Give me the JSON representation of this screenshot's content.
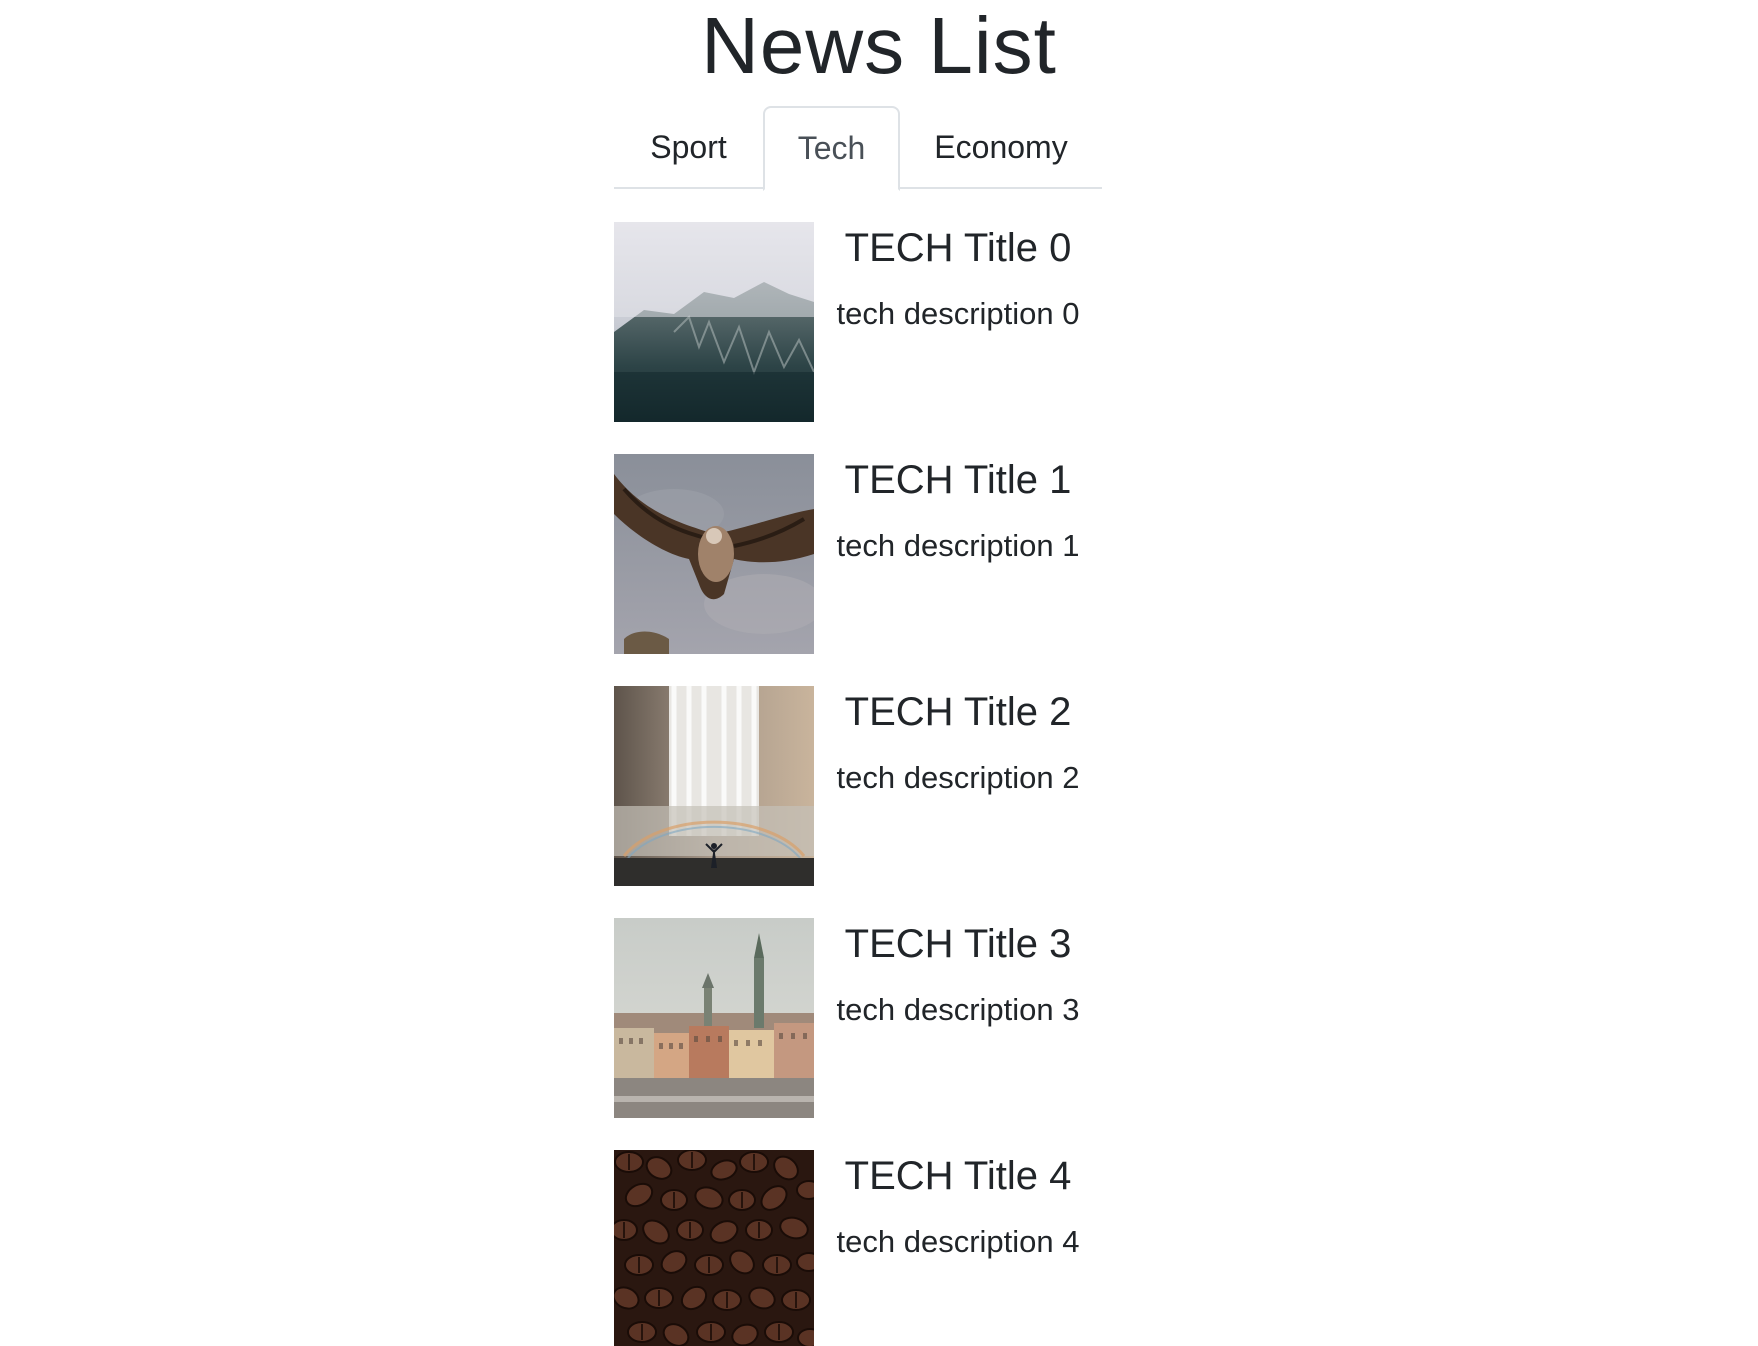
{
  "header": {
    "title": "News List"
  },
  "tabs": [
    {
      "label": "Sport",
      "active": false
    },
    {
      "label": "Tech",
      "active": true
    },
    {
      "label": "Economy",
      "active": false
    }
  ],
  "news": [
    {
      "title": "TECH Title 0",
      "description": "tech description 0",
      "image": "misty-mountain"
    },
    {
      "title": "TECH Title 1",
      "description": "tech description 1",
      "image": "vulture-flying"
    },
    {
      "title": "TECH Title 2",
      "description": "tech description 2",
      "image": "waterfall-rainbow"
    },
    {
      "title": "TECH Title 3",
      "description": "tech description 3",
      "image": "city-skyline"
    },
    {
      "title": "TECH Title 4",
      "description": "tech description 4",
      "image": "coffee-beans"
    }
  ]
}
